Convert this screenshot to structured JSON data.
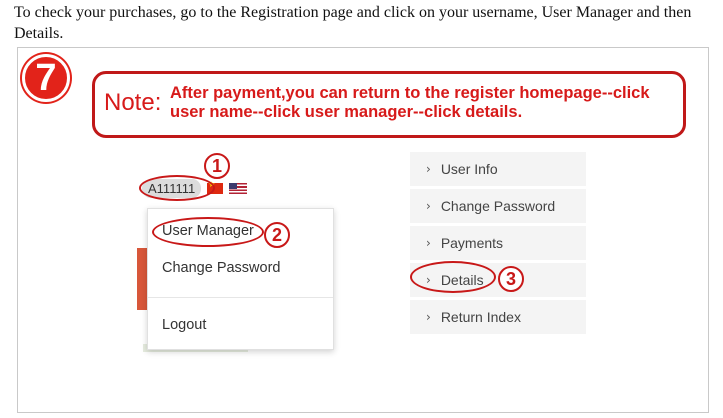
{
  "intro": "To check your purchases, go to the Registration page and click on your username, User Manager and then Details.",
  "step_number": "7",
  "note": {
    "label": "Note:",
    "text": "After payment,you can return to the register homepage--click user name--click user manager--click details."
  },
  "user": {
    "username": "A111111"
  },
  "dropdown": {
    "items": [
      "User Manager",
      "Change Password",
      "Logout"
    ]
  },
  "right_menu": {
    "items": [
      "User Info",
      "Change Password",
      "Payments",
      "Details",
      "Return Index"
    ]
  },
  "markers": [
    "1",
    "2",
    "3"
  ],
  "colors": {
    "accent_red": "#c81818",
    "menu_bg": "#f4f4f4"
  },
  "icons": [
    "china-flag-icon",
    "us-flag-icon",
    "chevron-right-icon"
  ]
}
